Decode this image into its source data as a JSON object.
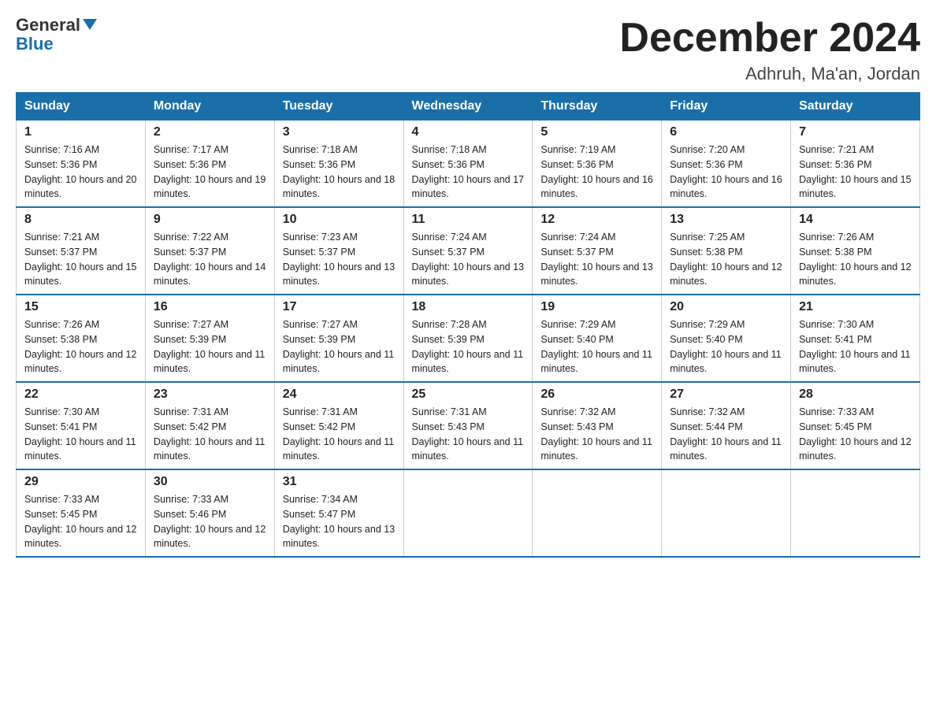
{
  "logo": {
    "word1": "General",
    "word2": "Blue"
  },
  "title": "December 2024",
  "location": "Adhruh, Ma'an, Jordan",
  "days_of_week": [
    "Sunday",
    "Monday",
    "Tuesday",
    "Wednesday",
    "Thursday",
    "Friday",
    "Saturday"
  ],
  "weeks": [
    [
      {
        "day": "1",
        "sunrise": "7:16 AM",
        "sunset": "5:36 PM",
        "daylight": "10 hours and 20 minutes."
      },
      {
        "day": "2",
        "sunrise": "7:17 AM",
        "sunset": "5:36 PM",
        "daylight": "10 hours and 19 minutes."
      },
      {
        "day": "3",
        "sunrise": "7:18 AM",
        "sunset": "5:36 PM",
        "daylight": "10 hours and 18 minutes."
      },
      {
        "day": "4",
        "sunrise": "7:18 AM",
        "sunset": "5:36 PM",
        "daylight": "10 hours and 17 minutes."
      },
      {
        "day": "5",
        "sunrise": "7:19 AM",
        "sunset": "5:36 PM",
        "daylight": "10 hours and 16 minutes."
      },
      {
        "day": "6",
        "sunrise": "7:20 AM",
        "sunset": "5:36 PM",
        "daylight": "10 hours and 16 minutes."
      },
      {
        "day": "7",
        "sunrise": "7:21 AM",
        "sunset": "5:36 PM",
        "daylight": "10 hours and 15 minutes."
      }
    ],
    [
      {
        "day": "8",
        "sunrise": "7:21 AM",
        "sunset": "5:37 PM",
        "daylight": "10 hours and 15 minutes."
      },
      {
        "day": "9",
        "sunrise": "7:22 AM",
        "sunset": "5:37 PM",
        "daylight": "10 hours and 14 minutes."
      },
      {
        "day": "10",
        "sunrise": "7:23 AM",
        "sunset": "5:37 PM",
        "daylight": "10 hours and 13 minutes."
      },
      {
        "day": "11",
        "sunrise": "7:24 AM",
        "sunset": "5:37 PM",
        "daylight": "10 hours and 13 minutes."
      },
      {
        "day": "12",
        "sunrise": "7:24 AM",
        "sunset": "5:37 PM",
        "daylight": "10 hours and 13 minutes."
      },
      {
        "day": "13",
        "sunrise": "7:25 AM",
        "sunset": "5:38 PM",
        "daylight": "10 hours and 12 minutes."
      },
      {
        "day": "14",
        "sunrise": "7:26 AM",
        "sunset": "5:38 PM",
        "daylight": "10 hours and 12 minutes."
      }
    ],
    [
      {
        "day": "15",
        "sunrise": "7:26 AM",
        "sunset": "5:38 PM",
        "daylight": "10 hours and 12 minutes."
      },
      {
        "day": "16",
        "sunrise": "7:27 AM",
        "sunset": "5:39 PM",
        "daylight": "10 hours and 11 minutes."
      },
      {
        "day": "17",
        "sunrise": "7:27 AM",
        "sunset": "5:39 PM",
        "daylight": "10 hours and 11 minutes."
      },
      {
        "day": "18",
        "sunrise": "7:28 AM",
        "sunset": "5:39 PM",
        "daylight": "10 hours and 11 minutes."
      },
      {
        "day": "19",
        "sunrise": "7:29 AM",
        "sunset": "5:40 PM",
        "daylight": "10 hours and 11 minutes."
      },
      {
        "day": "20",
        "sunrise": "7:29 AM",
        "sunset": "5:40 PM",
        "daylight": "10 hours and 11 minutes."
      },
      {
        "day": "21",
        "sunrise": "7:30 AM",
        "sunset": "5:41 PM",
        "daylight": "10 hours and 11 minutes."
      }
    ],
    [
      {
        "day": "22",
        "sunrise": "7:30 AM",
        "sunset": "5:41 PM",
        "daylight": "10 hours and 11 minutes."
      },
      {
        "day": "23",
        "sunrise": "7:31 AM",
        "sunset": "5:42 PM",
        "daylight": "10 hours and 11 minutes."
      },
      {
        "day": "24",
        "sunrise": "7:31 AM",
        "sunset": "5:42 PM",
        "daylight": "10 hours and 11 minutes."
      },
      {
        "day": "25",
        "sunrise": "7:31 AM",
        "sunset": "5:43 PM",
        "daylight": "10 hours and 11 minutes."
      },
      {
        "day": "26",
        "sunrise": "7:32 AM",
        "sunset": "5:43 PM",
        "daylight": "10 hours and 11 minutes."
      },
      {
        "day": "27",
        "sunrise": "7:32 AM",
        "sunset": "5:44 PM",
        "daylight": "10 hours and 11 minutes."
      },
      {
        "day": "28",
        "sunrise": "7:33 AM",
        "sunset": "5:45 PM",
        "daylight": "10 hours and 12 minutes."
      }
    ],
    [
      {
        "day": "29",
        "sunrise": "7:33 AM",
        "sunset": "5:45 PM",
        "daylight": "10 hours and 12 minutes."
      },
      {
        "day": "30",
        "sunrise": "7:33 AM",
        "sunset": "5:46 PM",
        "daylight": "10 hours and 12 minutes."
      },
      {
        "day": "31",
        "sunrise": "7:34 AM",
        "sunset": "5:47 PM",
        "daylight": "10 hours and 13 minutes."
      },
      null,
      null,
      null,
      null
    ]
  ]
}
